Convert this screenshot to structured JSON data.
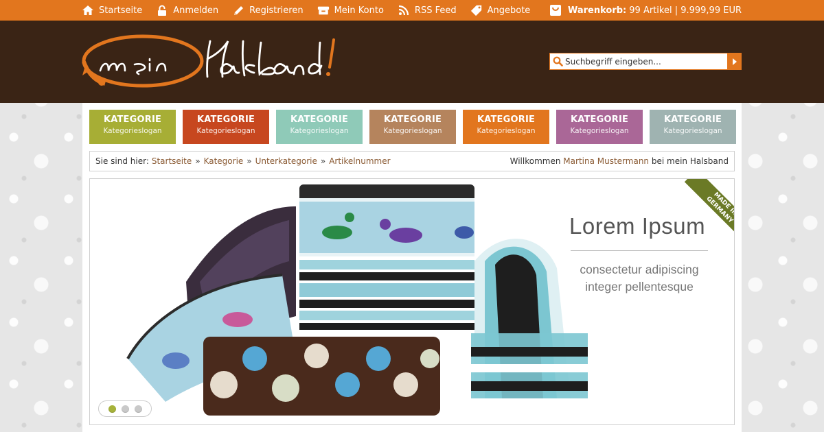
{
  "topnav": {
    "items": [
      {
        "label": "Startseite",
        "icon": "home-icon"
      },
      {
        "label": "Anmelden",
        "icon": "lock-icon"
      },
      {
        "label": "Registrieren",
        "icon": "pencil-icon"
      },
      {
        "label": "Mein Konto",
        "icon": "box-icon"
      },
      {
        "label": "RSS Feed",
        "icon": "rss-icon"
      },
      {
        "label": "Angebote",
        "icon": "tag-icon"
      }
    ],
    "cart": {
      "label": "Warenkorb:",
      "summary": "99 Artikel | 9.999,99 EUR",
      "icon": "cart-bag-icon"
    }
  },
  "header": {
    "logo_text": "mein Halsband!",
    "search": {
      "placeholder": "Suchbegriff eingeben..."
    }
  },
  "categories": [
    {
      "title": "KATEGORIE",
      "slogan": "Kategorieslogan",
      "color": "#a7ae35"
    },
    {
      "title": "KATEGORIE",
      "slogan": "Kategorieslogan",
      "color": "#c7471f"
    },
    {
      "title": "KATEGORIE",
      "slogan": "Kategorieslogan",
      "color": "#8fcab8"
    },
    {
      "title": "KATEGORIE",
      "slogan": "Kategorieslogan",
      "color": "#b5845d"
    },
    {
      "title": "KATEGORIE",
      "slogan": "Kategorieslogan",
      "color": "#e2761e"
    },
    {
      "title": "KATEGORIE",
      "slogan": "Kategorieslogan",
      "color": "#aa6797"
    },
    {
      "title": "KATEGORIE",
      "slogan": "Kategorieslogan",
      "color": "#9fb3b1"
    }
  ],
  "breadcrumb": {
    "prefix": "Sie sind hier:",
    "items": [
      "Startseite",
      "Kategorie",
      "Unterkategorie",
      "Artikelnummer"
    ],
    "separator": "»",
    "welcome_prefix": "Willkommen",
    "user_name": "Martina Mustermann",
    "welcome_suffix": "bei mein Halsband"
  },
  "slider": {
    "title": "Lorem Ipsum",
    "subtitle_line1": "consectetur adipiscing",
    "subtitle_line2": "integer pellentesque",
    "ribbon_line1": "MADE IN",
    "ribbon_line2": "GERMANY",
    "slides": 3,
    "active_slide": 1
  },
  "colors": {
    "accent": "#e2761e",
    "header_bg": "#3a2415",
    "link": "#8a5a33",
    "ribbon": "#6b7a26"
  }
}
